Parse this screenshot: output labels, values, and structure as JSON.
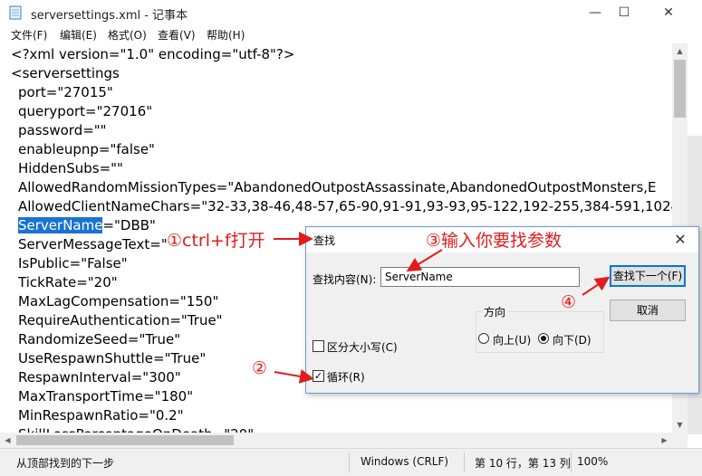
{
  "window": {
    "title": "serversettings.xml - 记事本",
    "minimize_glyph": "—",
    "maximize_glyph": "☐",
    "close_glyph": "✕"
  },
  "menu": [
    "文件(F)",
    "编辑(E)",
    "格式(O)",
    "查看(V)",
    "帮助(H)"
  ],
  "editor": {
    "lines": [
      "<?xml version=\"1.0\" encoding=\"utf-8\"?>",
      "<serversettings",
      "port=\"27015\"",
      "queryport=\"27016\"",
      "password=\"\"",
      "enableupnp=\"false\"",
      "HiddenSubs=\"\"",
      "AllowedRandomMissionTypes=\"AbandonedOutpostAssassinate,AbandonedOutpostMonsters,E",
      "AllowedClientNameChars=\"32-33,38-46,48-57,65-90,91-91,93-93,95-122,192-255,384-591,1024",
      "=\"DBB\"",
      "ServerMessageText=\"",
      "IsPublic=\"False\"",
      "TickRate=\"20\"",
      "MaxLagCompensation=\"150\"",
      "RequireAuthentication=\"True\"",
      "RandomizeSeed=\"True\"",
      "UseRespawnShuttle=\"True\"",
      "RespawnInterval=\"300\"",
      "MaxTransportTime=\"180\"",
      "MinRespawnRatio=\"0.2\"",
      "SkillLossPercentageOnDeath=\"20\""
    ],
    "selected_text": "ServerName"
  },
  "statusbar": {
    "message": "从顶部找到的下一步",
    "line_ending": "Windows (CRLF)",
    "position": "第 10 行，第 13 列",
    "zoom": "100%"
  },
  "find_dialog": {
    "title": "查找",
    "find_label": "查找内容(N):",
    "find_value": "ServerName",
    "find_next_button": "查找下一个(F)",
    "cancel_button": "取消",
    "direction_label": "方向",
    "up_label": "向上(U)",
    "down_label": "向下(D)",
    "direction_selected": "down",
    "match_case_label": "区分大小写(C)",
    "match_case_checked": false,
    "wrap_label": "循环(R)",
    "wrap_checked": true,
    "close_glyph": "✕"
  },
  "annotations": {
    "step1": "①ctrl+f打开",
    "step2": "②",
    "step3": "③输入你要找参数",
    "step4": "④",
    "color": "#e21c1c"
  },
  "colors": {
    "selection": "#1a73d1",
    "dialog_border": "#6c9bd2",
    "primary_button_border": "#0078d7"
  }
}
